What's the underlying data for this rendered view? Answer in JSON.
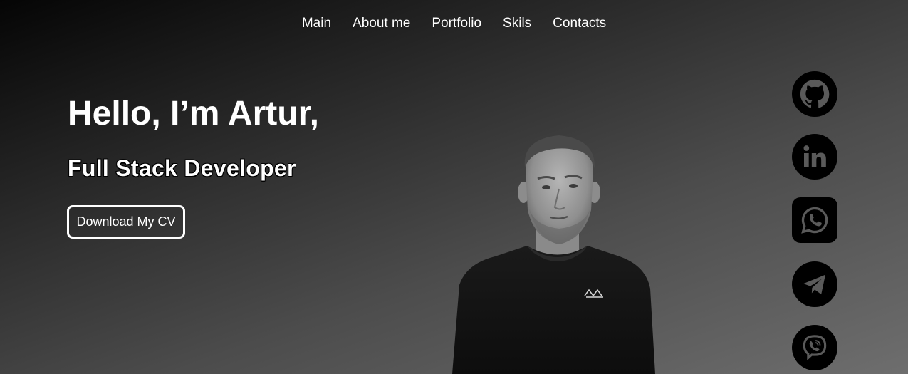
{
  "nav": {
    "items": [
      {
        "label": "Main"
      },
      {
        "label": "About me"
      },
      {
        "label": "Portfolio"
      },
      {
        "label": "Skils"
      },
      {
        "label": "Contacts"
      }
    ]
  },
  "hero": {
    "title": "Hello, I’m Artur,",
    "subtitle": "Full Stack Developer",
    "cv_button_label": "Download My CV"
  },
  "social": {
    "icons": [
      "github-icon",
      "linkedin-icon",
      "whatsapp-icon",
      "telegram-icon",
      "viber-icon"
    ]
  },
  "colors": {
    "text": "#ffffff",
    "icon_background": "#000000",
    "gradient_dark": "#050505",
    "gradient_light": "#6e6e6e"
  }
}
